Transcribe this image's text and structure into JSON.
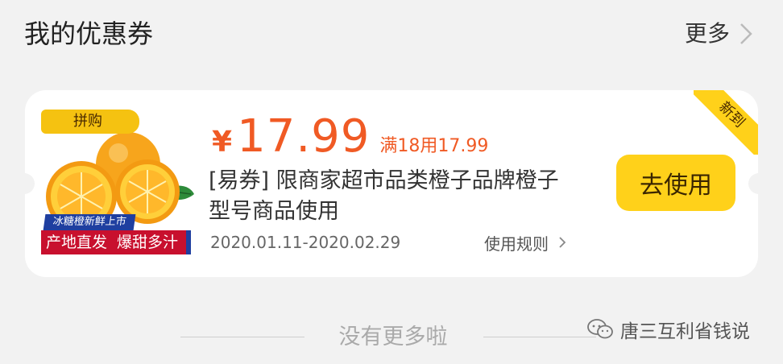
{
  "header": {
    "title": "我的优惠券",
    "more_label": "更多"
  },
  "coupon": {
    "tag": "拼购",
    "promo_top": "冰糖橙新鲜上市",
    "promo_left": "产地直发",
    "promo_right": "爆甜多汁",
    "currency": "¥",
    "amount": "17.99",
    "condition": "满18用17.99",
    "description": "[易券] 限商家超市品类橙子品牌橙子型号商品使用",
    "validity": "2020.01.11-2020.02.29",
    "rules_label": "使用规则",
    "use_button_label": "去使用",
    "ribbon_label": "新到"
  },
  "footer": {
    "end_text": "没有更多啦"
  },
  "watermark": {
    "text": "唐三互利省钱说"
  },
  "colors": {
    "background": "#f2f2f2",
    "accent_price": "#f05a24",
    "button_yellow": "#ffd11a",
    "tag_yellow": "#f5c211"
  }
}
